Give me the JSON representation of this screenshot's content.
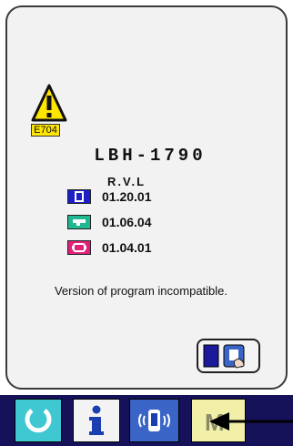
{
  "error": {
    "code": "E704",
    "model": "LBH-1790",
    "version_header": "R.V.L",
    "versions": [
      {
        "icon": "panel-version-icon",
        "color": "#1e1ec8",
        "value": "01.20.01"
      },
      {
        "icon": "main-shaft-version-icon",
        "color": "#20b890",
        "value": "01.06.04"
      },
      {
        "icon": "servo-version-icon",
        "color": "#e0207a",
        "value": "01.04.01"
      }
    ],
    "message": "Version of program incompatible."
  },
  "buttons": {
    "switch": {
      "icon": "communication-switch-icon"
    },
    "bottom": [
      {
        "icon": "reset-icon",
        "color": "#3fc7d2"
      },
      {
        "icon": "information-icon",
        "color": "#f3f3f3"
      },
      {
        "icon": "communication-icon",
        "color": "#3a64c6"
      },
      {
        "icon": "mode-icon",
        "color": "#f2f0a8"
      }
    ]
  },
  "colors": {
    "bar_background": "#16125a",
    "error_badge": "#ffe600"
  }
}
